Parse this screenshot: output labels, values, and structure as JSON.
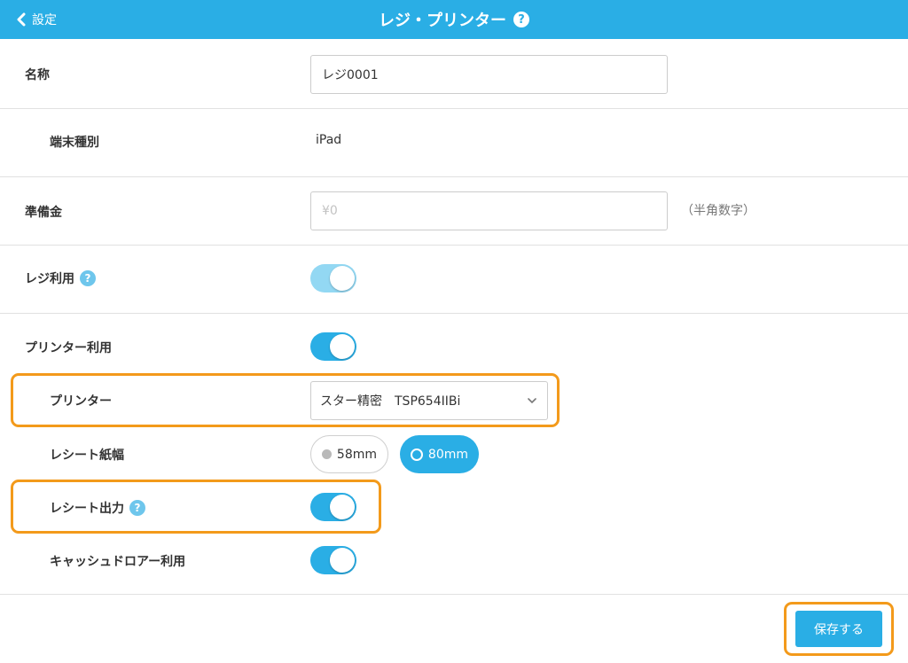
{
  "header": {
    "back_label": "設定",
    "title": "レジ・プリンター",
    "help": "?"
  },
  "form": {
    "name": {
      "label": "名称",
      "value": "レジ0001"
    },
    "device": {
      "label": "端末種別",
      "value": "iPad"
    },
    "cash": {
      "label": "準備金",
      "placeholder": "¥0",
      "hint": "（半角数字）"
    },
    "register_use": {
      "label": "レジ利用",
      "help": "?",
      "enabled": true
    },
    "printer_use": {
      "label": "プリンター利用",
      "enabled": true
    },
    "printer": {
      "label": "プリンター",
      "selected": "スター精密　TSP654IIBi"
    },
    "receipt_width": {
      "label": "レシート紙幅",
      "options": [
        "58mm",
        "80mm"
      ],
      "selected": "80mm"
    },
    "receipt_output": {
      "label": "レシート出力",
      "help": "?",
      "enabled": true
    },
    "cash_drawer": {
      "label": "キャッシュドロアー利用",
      "enabled": true
    }
  },
  "footer": {
    "save_label": "保存する"
  },
  "colors": {
    "accent": "#2aaee5",
    "highlight": "#f39a1b"
  }
}
